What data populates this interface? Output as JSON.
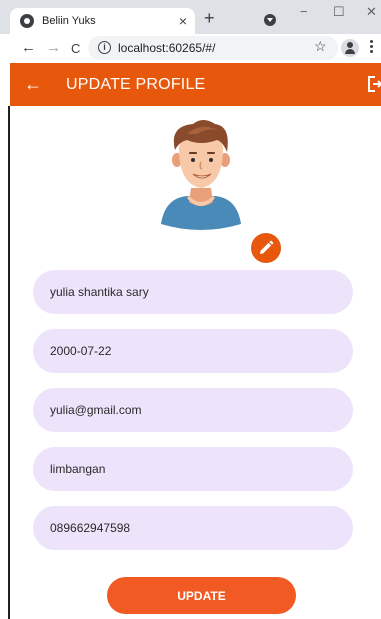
{
  "browser": {
    "tab_title": "Beliin Yuks",
    "tab_close": "×",
    "new_tab": "+",
    "url": "localhost:60265/#/",
    "window_min": "−",
    "window_max": "☐",
    "window_close": "✕",
    "nav_back": "←",
    "nav_forward": "→",
    "nav_reload": "C",
    "star": "☆",
    "info": "i"
  },
  "appbar": {
    "back_glyph": "←",
    "title": "UPDATE PROFILE",
    "color": "#e8580c"
  },
  "icons": {
    "tab_favicon": "globe-icon",
    "tab_search": "tab-search-icon",
    "profile": "account-icon",
    "menu": "kebab-menu-icon",
    "logout": "logout-icon",
    "edit": "pencil-icon",
    "avatar": "user-avatar"
  },
  "form": {
    "fields": [
      {
        "value": "yulia shantika sary"
      },
      {
        "value": "2000-07-22"
      },
      {
        "value": "yulia@gmail.com"
      },
      {
        "value": "limbangan"
      },
      {
        "value": "089662947598"
      }
    ],
    "field_color": "#ede3fb"
  },
  "update_button": {
    "label": "UPDATE",
    "color": "#f15a22"
  }
}
